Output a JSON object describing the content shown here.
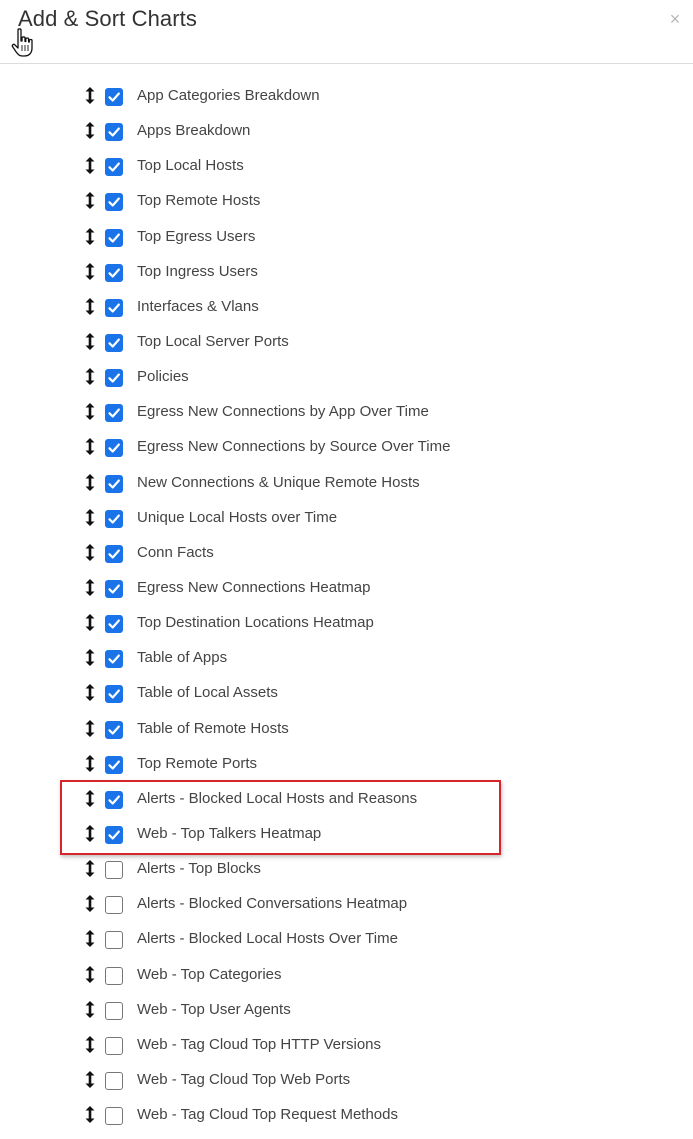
{
  "dialog": {
    "title": "Add & Sort Charts",
    "close_icon": "×"
  },
  "charts": [
    {
      "label": "App Categories Breakdown",
      "checked": true
    },
    {
      "label": "Apps Breakdown",
      "checked": true
    },
    {
      "label": "Top Local Hosts",
      "checked": true
    },
    {
      "label": "Top Remote Hosts",
      "checked": true
    },
    {
      "label": "Top Egress Users",
      "checked": true
    },
    {
      "label": "Top Ingress Users",
      "checked": true
    },
    {
      "label": "Interfaces & Vlans",
      "checked": true
    },
    {
      "label": "Top Local Server Ports",
      "checked": true
    },
    {
      "label": "Policies",
      "checked": true
    },
    {
      "label": "Egress New Connections by App Over Time",
      "checked": true
    },
    {
      "label": "Egress New Connections by Source Over Time",
      "checked": true
    },
    {
      "label": "New Connections & Unique Remote Hosts",
      "checked": true
    },
    {
      "label": "Unique Local Hosts over Time",
      "checked": true
    },
    {
      "label": "Conn Facts",
      "checked": true
    },
    {
      "label": "Egress New Connections Heatmap",
      "checked": true
    },
    {
      "label": "Top Destination Locations Heatmap",
      "checked": true
    },
    {
      "label": "Table of Apps",
      "checked": true
    },
    {
      "label": "Table of Local Assets",
      "checked": true
    },
    {
      "label": "Table of Remote Hosts",
      "checked": true
    },
    {
      "label": "Top Remote Ports",
      "checked": true
    },
    {
      "label": "Alerts - Blocked Local Hosts and Reasons",
      "checked": true
    },
    {
      "label": "Web - Top Talkers Heatmap",
      "checked": true
    },
    {
      "label": "Alerts - Top Blocks",
      "checked": false
    },
    {
      "label": "Alerts - Blocked Conversations Heatmap",
      "checked": false
    },
    {
      "label": "Alerts - Blocked Local Hosts Over Time",
      "checked": false
    },
    {
      "label": "Web - Top Categories",
      "checked": false
    },
    {
      "label": "Web - Top User Agents",
      "checked": false
    },
    {
      "label": "Web - Tag Cloud Top HTTP Versions",
      "checked": false
    },
    {
      "label": "Web - Tag Cloud Top Web Ports",
      "checked": false
    },
    {
      "label": "Web - Tag Cloud Top Request Methods",
      "checked": false
    }
  ],
  "icons": {
    "drag": "drag-handle-icon",
    "check": "checkmark-icon",
    "close": "close-icon",
    "cursor": "hand-pointer-cursor-icon"
  },
  "colors": {
    "checkbox_checked": "#1a73e8",
    "highlight_border": "#d6262b",
    "text": "#444444"
  }
}
